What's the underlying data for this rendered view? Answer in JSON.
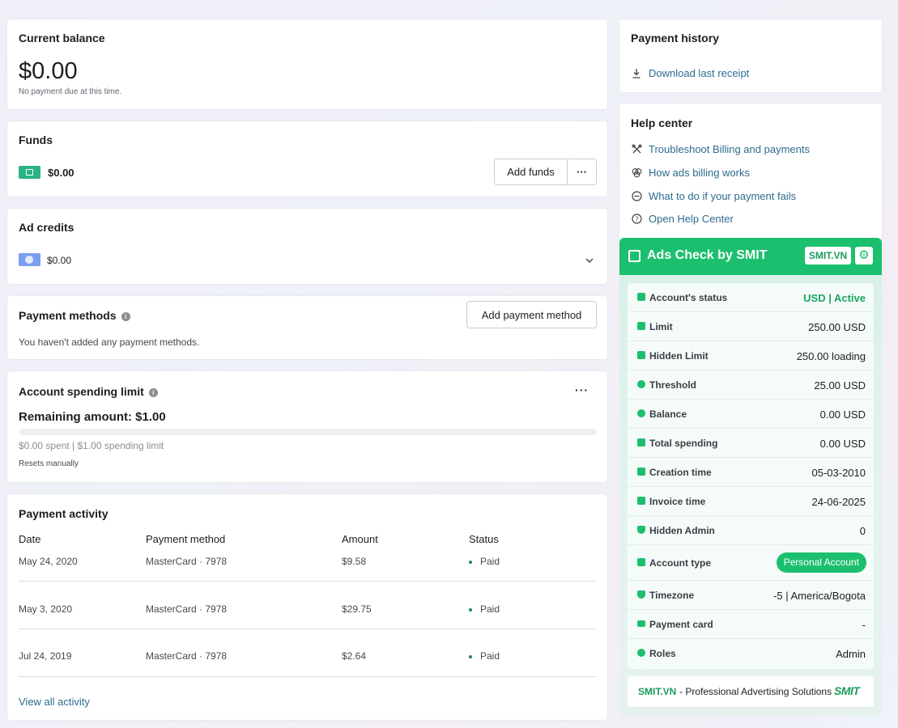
{
  "current_balance": {
    "title": "Current balance",
    "amount": "$0.00",
    "note": "No payment due at this time."
  },
  "funds": {
    "title": "Funds",
    "amount": "$0.00",
    "add_label": "Add funds",
    "more_label": "···"
  },
  "ad_credits": {
    "title": "Ad credits",
    "amount": "$0.00"
  },
  "payment_methods": {
    "title": "Payment methods",
    "add_label": "Add payment method",
    "empty_text": "You haven't added any payment methods."
  },
  "spending_limit": {
    "title": "Account spending limit",
    "remaining": "Remaining amount: $1.00",
    "detail": "$0.00 spent | $1.00 spending limit",
    "reset": "Resets manually",
    "spent_fraction": 0.0,
    "more_label": "···"
  },
  "payment_activity": {
    "title": "Payment activity",
    "columns": [
      "Date",
      "Payment method",
      "Amount",
      "Status"
    ],
    "rows": [
      {
        "date": "May 24, 2020",
        "method": "MasterCard · 7978",
        "amount": "$9.58",
        "status": "Paid"
      },
      {
        "date": "May 3, 2020",
        "method": "MasterCard · 7978",
        "amount": "$29.75",
        "status": "Paid"
      },
      {
        "date": "Jul 24, 2019",
        "method": "MasterCard · 7978",
        "amount": "$2.64",
        "status": "Paid"
      }
    ],
    "view_all": "View all activity"
  },
  "payment_history": {
    "title": "Payment history",
    "download": "Download last receipt"
  },
  "help_center": {
    "title": "Help center",
    "items": [
      {
        "label": "Troubleshoot Billing and payments",
        "icon": "tools-icon"
      },
      {
        "label": "How ads billing works",
        "icon": "circles-icon"
      },
      {
        "label": "What to do if your payment fails",
        "icon": "minus-circle-icon"
      },
      {
        "label": "Open Help Center",
        "icon": "question-icon"
      }
    ]
  },
  "smit": {
    "title": "Ads Check by SMIT",
    "badge": "SMIT.VN",
    "accent": "#1cbf6e",
    "rows": [
      {
        "label": "Account's status",
        "value": "USD | Active"
      },
      {
        "label": "Limit",
        "value": "250.00 USD"
      },
      {
        "label": "Hidden Limit",
        "value": "250.00 loading"
      },
      {
        "label": "Threshold",
        "value": "25.00 USD"
      },
      {
        "label": "Balance",
        "value": "0.00 USD"
      },
      {
        "label": "Total spending",
        "value": "0.00 USD"
      },
      {
        "label": "Creation time",
        "value": "05-03-2010"
      },
      {
        "label": "Invoice time",
        "value": "24-06-2025"
      },
      {
        "label": "Hidden Admin",
        "value": "0"
      },
      {
        "label": "Account type",
        "value": "Personal Account"
      },
      {
        "label": "Timezone",
        "value": "-5 | America/Bogota"
      },
      {
        "label": "Payment card",
        "value": "-"
      },
      {
        "label": "Roles",
        "value": "Admin"
      }
    ],
    "footer_brand": "SMIT.VN",
    "footer_text": " - Professional Advertising Solutions",
    "footer_logo": "SMIT"
  }
}
